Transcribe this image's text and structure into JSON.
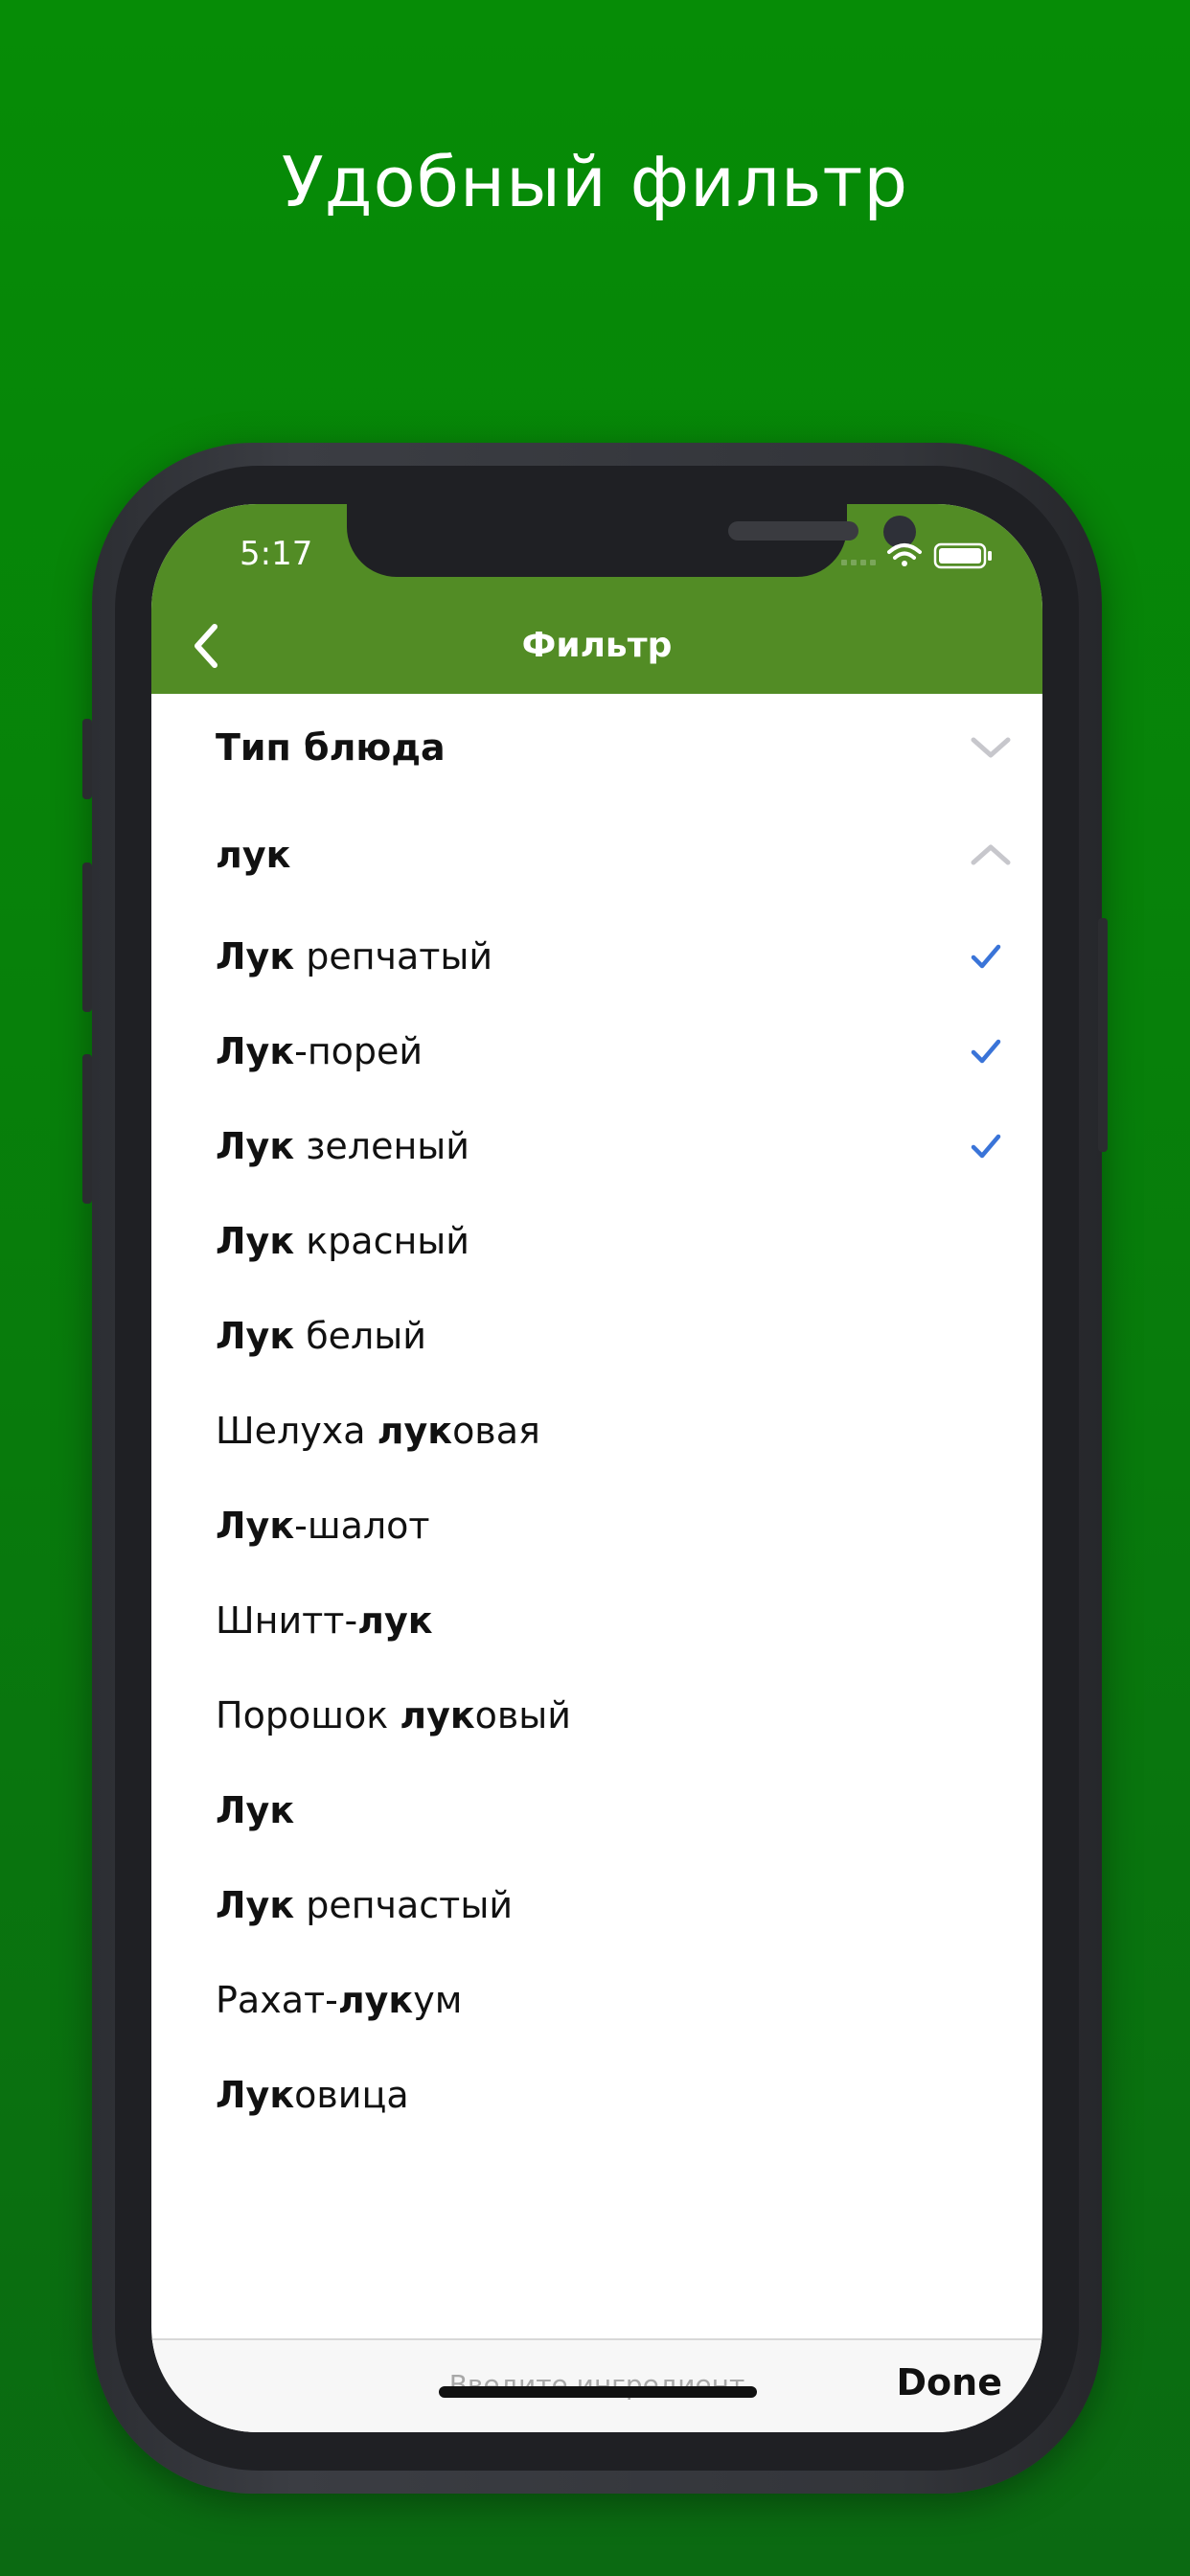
{
  "headline": "Удобный фильтр",
  "status_bar": {
    "time": "5:17",
    "icons": [
      "signal-icon",
      "wifi-icon",
      "battery-icon"
    ]
  },
  "nav": {
    "title": "Фильтр",
    "back_icon": "chevron-left-icon"
  },
  "sections": [
    {
      "label": "Тип блюда",
      "expanded": false
    },
    {
      "label": "лук",
      "expanded": true
    }
  ],
  "items": [
    {
      "parts": [
        {
          "t": "Лук",
          "b": true
        },
        {
          "t": " репчатый",
          "b": false
        }
      ],
      "checked": true
    },
    {
      "parts": [
        {
          "t": "Лук",
          "b": true
        },
        {
          "t": "-порей",
          "b": false
        }
      ],
      "checked": true
    },
    {
      "parts": [
        {
          "t": "Лук",
          "b": true
        },
        {
          "t": " зеленый",
          "b": false
        }
      ],
      "checked": true
    },
    {
      "parts": [
        {
          "t": "Лук",
          "b": true
        },
        {
          "t": " красный",
          "b": false
        }
      ],
      "checked": false
    },
    {
      "parts": [
        {
          "t": "Лук",
          "b": true
        },
        {
          "t": " белый",
          "b": false
        }
      ],
      "checked": false
    },
    {
      "parts": [
        {
          "t": "Шелуха ",
          "b": false
        },
        {
          "t": "лук",
          "b": true
        },
        {
          "t": "овая",
          "b": false
        }
      ],
      "checked": false
    },
    {
      "parts": [
        {
          "t": "Лук",
          "b": true
        },
        {
          "t": "-шалот",
          "b": false
        }
      ],
      "checked": false
    },
    {
      "parts": [
        {
          "t": "Шнитт-",
          "b": false
        },
        {
          "t": "лук",
          "b": true
        }
      ],
      "checked": false
    },
    {
      "parts": [
        {
          "t": "Порошок ",
          "b": false
        },
        {
          "t": "лук",
          "b": true
        },
        {
          "t": "овый",
          "b": false
        }
      ],
      "checked": false
    },
    {
      "parts": [
        {
          "t": "Лук",
          "b": true
        }
      ],
      "checked": false
    },
    {
      "parts": [
        {
          "t": "Лук",
          "b": true
        },
        {
          "t": " репчастый",
          "b": false
        }
      ],
      "checked": false
    },
    {
      "parts": [
        {
          "t": "Рахат-",
          "b": false
        },
        {
          "t": "лук",
          "b": true
        },
        {
          "t": "ум",
          "b": false
        }
      ],
      "checked": false
    },
    {
      "parts": [
        {
          "t": "Лук",
          "b": true
        },
        {
          "t": "овица",
          "b": false
        }
      ],
      "checked": false
    }
  ],
  "bottom_bar": {
    "input_placeholder": "Введите ингредиент",
    "input_value": "",
    "done_label": "Done"
  },
  "colors": {
    "background": "#07850a",
    "nav_bar": "#528c25",
    "checkmark": "#3a74d8",
    "chevron": "#c7c7cc"
  }
}
